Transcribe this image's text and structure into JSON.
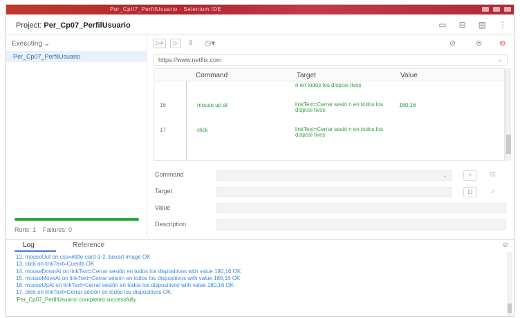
{
  "chrome": {
    "title_text": "Per_CpII7_PerfilUsuario - Selenium IDE"
  },
  "project": {
    "prefix": "Project:",
    "name": "Per_Cp07_PerfilUsuario"
  },
  "header_icons": [
    "folder-icon",
    "open-icon",
    "save-icon",
    "more-icon"
  ],
  "left": {
    "mode": "Executing",
    "suite": "Per_Cp07_PerfilUsuario",
    "progress": 1.0,
    "runs_label": "Runs: 1",
    "failures_label": "Failures: 0"
  },
  "toolbar": {
    "run_all": "▷≡",
    "run_one": "▷",
    "pause": "||",
    "speed": "◷▾"
  },
  "url": {
    "value": "https://www.netflix.com"
  },
  "table": {
    "headers": {
      "command": "Command",
      "target": "Target",
      "value": "Value"
    },
    "rows": [
      {
        "idx": "",
        "command": "",
        "target": "n en todos los disposi tivos",
        "value": ""
      },
      {
        "idx": "16",
        "command": "mouse up at",
        "target": "linkText=Cerrar sesió n en todos los disposi tivos",
        "value": "180,16"
      },
      {
        "idx": "17",
        "command": "click",
        "target": "linkText=Cerrar sesió n en todos los disposi tivos",
        "value": ""
      }
    ]
  },
  "form": {
    "command_label": "Command",
    "target_label": "Target",
    "value_label": "Value",
    "description_label": "Description",
    "command_plus": "+",
    "command_open": "⎘",
    "target_select": "⊡",
    "target_find": "⌕"
  },
  "log": {
    "tab_log": "Log",
    "tab_reference": "Reference",
    "lines": [
      "12. mouseOut on css=#title-card-1-2 .boxart-image OK",
      "13. click on linkText=Cuenta OK",
      "14. mouseDownAt on linkText=Cerrar sesión en todos los dispositivos with value 180,16 OK",
      "15. mouseMoveAt on linkText=Cerrar sesión en todos los dispositivos with value 180,16 OK",
      "16. mouseUpAt on linkText=Cerrar sesión en todos los dispositivos with value 180,16 OK",
      "17. click on linkText=Cerrar sesión en todos los dispositivos OK"
    ],
    "success": "'Per_Cp07_PerfilUsuario' completed successfully"
  }
}
